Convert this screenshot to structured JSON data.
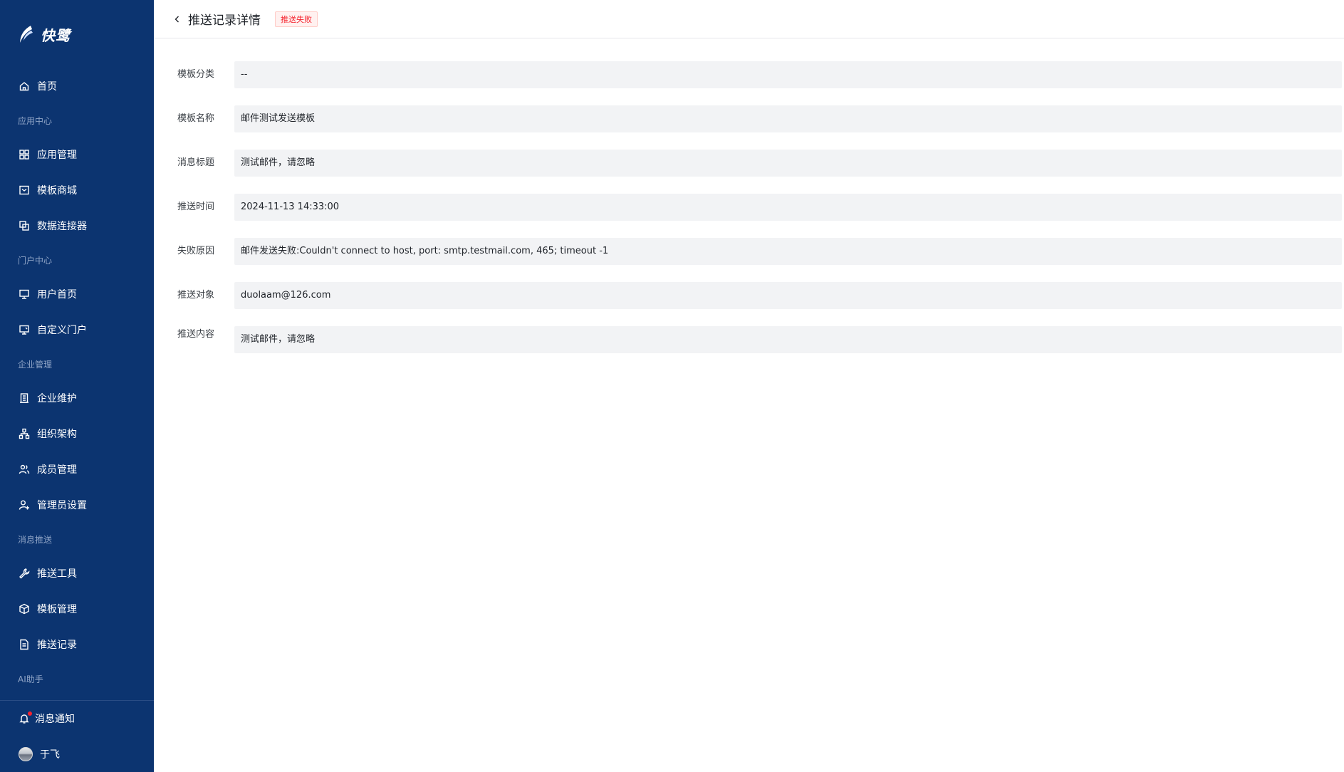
{
  "brand": {
    "name": "快鹭"
  },
  "nav": {
    "home": "首页",
    "sections": [
      {
        "title": "应用中心",
        "items": [
          "应用管理",
          "模板商城",
          "数据连接器"
        ]
      },
      {
        "title": "门户中心",
        "items": [
          "用户首页",
          "自定义门户"
        ]
      },
      {
        "title": "企业管理",
        "items": [
          "企业维护",
          "组织架构",
          "成员管理",
          "管理员设置"
        ]
      },
      {
        "title": "消息推送",
        "items": [
          "推送工具",
          "模板管理",
          "推送记录"
        ]
      },
      {
        "title": "AI助手",
        "items": []
      }
    ],
    "notifications": "消息通知",
    "user": "于飞"
  },
  "header": {
    "title": "推送记录详情",
    "status": "推送失败",
    "status_color": "#f5222d"
  },
  "fields": [
    {
      "label": "模板分类",
      "value": "--"
    },
    {
      "label": "模板名称",
      "value": "邮件测试发送模板"
    },
    {
      "label": "消息标题",
      "value": "测试邮件，请忽略"
    },
    {
      "label": "推送时间",
      "value": "2024-11-13 14:33:00"
    },
    {
      "label": "失败原因",
      "value": "邮件发送失败:Couldn't connect to host, port: smtp.testmail.com, 465; timeout -1"
    },
    {
      "label": "推送对象",
      "value": "duolaam@126.com"
    },
    {
      "label": "推送内容",
      "value": "测试邮件，请忽略"
    }
  ],
  "colors": {
    "sidebar": "#0c3470",
    "field_bg": "#f2f3f5"
  }
}
